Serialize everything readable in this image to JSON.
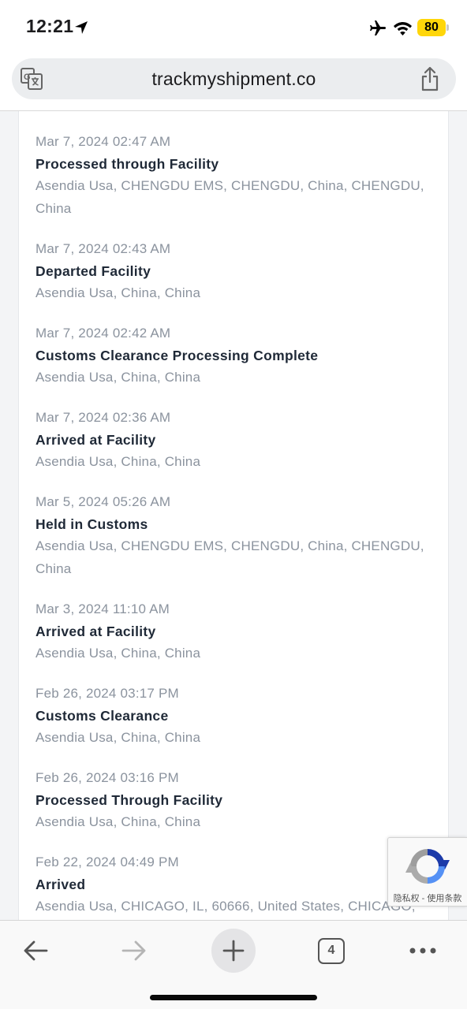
{
  "status_bar": {
    "time": "12:21",
    "battery": "80",
    "icons": [
      "location-arrow-icon",
      "airplane-icon",
      "wifi-icon",
      "battery-icon"
    ]
  },
  "browser": {
    "url": "trackmyshipment.co",
    "left_icon": "translate-icon",
    "right_icon": "share-icon"
  },
  "events": [
    {
      "date": "Mar 7, 2024 02:47 AM",
      "status": "Processed through Facility",
      "location": "Asendia Usa, CHENGDU EMS, CHENGDU, China, CHENGDU, China"
    },
    {
      "date": "Mar 7, 2024 02:43 AM",
      "status": "Departed Facility",
      "location": "Asendia Usa, China, China"
    },
    {
      "date": "Mar 7, 2024 02:42 AM",
      "status": "Customs Clearance Processing Complete",
      "location": "Asendia Usa, China, China"
    },
    {
      "date": "Mar 7, 2024 02:36 AM",
      "status": "Arrived at Facility",
      "location": "Asendia Usa, China, China"
    },
    {
      "date": "Mar 5, 2024 05:26 AM",
      "status": "Held in Customs",
      "location": "Asendia Usa, CHENGDU EMS, CHENGDU, China, CHENGDU, China"
    },
    {
      "date": "Mar 3, 2024 11:10 AM",
      "status": "Arrived at Facility",
      "location": "Asendia Usa, China, China"
    },
    {
      "date": "Feb 26, 2024 03:17 PM",
      "status": "Customs Clearance",
      "location": "Asendia Usa, China, China"
    },
    {
      "date": "Feb 26, 2024 03:16 PM",
      "status": "Processed Through Facility",
      "location": "Asendia Usa, China, China"
    },
    {
      "date": "Feb 22, 2024 04:49 PM",
      "status": "Arrived",
      "location": "Asendia Usa, CHICAGO, IL, 60666, United States, CHICAGO,"
    }
  ],
  "recaptcha": {
    "links": "隐私权 - 使用条款"
  },
  "toolbar": {
    "tab_count": "4",
    "icons": [
      "back-arrow-icon",
      "forward-arrow-icon",
      "plus-icon",
      "tabs-icon",
      "more-icon"
    ]
  },
  "colors": {
    "battery": "#ffd60a",
    "meta_text": "#8b939e",
    "status_text": "#1f2937",
    "url_bar": "#ebedef"
  }
}
